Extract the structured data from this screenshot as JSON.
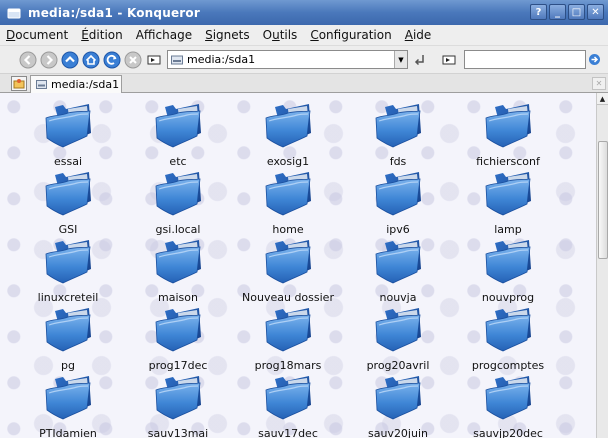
{
  "window": {
    "title": "media:/sda1 - Konqueror",
    "buttons": {
      "help": "?",
      "minimize": "_",
      "maximize": "□",
      "close": "✕"
    }
  },
  "menubar": {
    "items": [
      {
        "underline": "D",
        "rest": "ocument"
      },
      {
        "underline": "É",
        "rest": "dition"
      },
      {
        "pre": "Affichage",
        "underline": "",
        "rest": ""
      },
      {
        "underline": "S",
        "rest": "ignets"
      },
      {
        "pre": "O",
        "underline": "u",
        "rest": "tils"
      },
      {
        "underline": "C",
        "rest": "onfiguration"
      },
      {
        "underline": "A",
        "rest": "ide"
      }
    ]
  },
  "toolbar": {
    "location": "media:/sda1",
    "search_value": "",
    "icons": [
      "back-icon",
      "forward-icon",
      "up-icon",
      "home-icon",
      "reload-icon",
      "stop-icon",
      "location-label-icon",
      "clear-location-icon",
      "search-label-icon",
      "search-go-icon"
    ]
  },
  "tabs": [
    {
      "label": "media:/sda1"
    }
  ],
  "folders": [
    "essai",
    "etc",
    "exosig1",
    "fds",
    "fichiersconf",
    "GSI",
    "gsi.local",
    "home",
    "ipv6",
    "lamp",
    "linuxcreteil",
    "maison",
    "Nouveau dossier",
    "nouvja",
    "nouvprog",
    "pg",
    "prog17dec",
    "prog18mars",
    "prog20avril",
    "progcomptes",
    "PTIdamien",
    "sauv13mai",
    "sauv17dec",
    "sauv20juin",
    "sauvjp20dec"
  ],
  "colors": {
    "titlebar": "#4a78bb",
    "folder_front": "#3f86d6",
    "folder_back": "#1e57b0"
  }
}
